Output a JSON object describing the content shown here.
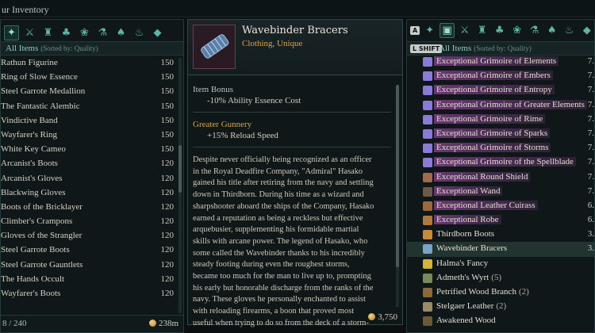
{
  "top": {
    "title": "ur Inventory"
  },
  "left": {
    "sort_label": "All Items",
    "sort_sub": "(Sorted by: Quality)",
    "partial_top": "...",
    "items": [
      {
        "name": "Rathun Figurine",
        "value": "150"
      },
      {
        "name": "Ring of Slow Essence",
        "value": "150"
      },
      {
        "name": "Steel Garrote Medallion",
        "value": "150"
      },
      {
        "name": "The Fantastic Alembic",
        "value": "150"
      },
      {
        "name": "Vindictive Band",
        "value": "150"
      },
      {
        "name": "Wayfarer's Ring",
        "value": "150"
      },
      {
        "name": "White Key Cameo",
        "value": "150"
      },
      {
        "name": "Arcanist's Boots",
        "value": "120"
      },
      {
        "name": "Arcanist's Gloves",
        "value": "120"
      },
      {
        "name": "Blackwing Gloves",
        "value": "120"
      },
      {
        "name": "Boots of the Bricklayer",
        "value": "120"
      },
      {
        "name": "Climber's Crampons",
        "value": "120"
      },
      {
        "name": "Gloves of the Strangler",
        "value": "120"
      },
      {
        "name": "Steel Garrote Boots",
        "value": "120"
      },
      {
        "name": "Steel Garrote Gauntlets",
        "value": "120"
      },
      {
        "name": "The Hands Occult",
        "value": "120"
      },
      {
        "name": "Wayfarer's Boots",
        "value": "120"
      }
    ],
    "footer_count": "8 / 240",
    "footer_gold": "238m"
  },
  "middle": {
    "item_name": "Wavebinder Bracers",
    "item_sub": "Clothing, Unique",
    "bonus_title": "Item Bonus",
    "bonus_line": "-10% Ability Essence Cost",
    "gunnery_title": "Greater Gunnery",
    "gunnery_line": "+15% Reload Speed",
    "description": "Despite never officially being recognized as an officer\nin the Royal Deadfire Company, \"Admiral\" Hasako\ngained his title after retiring from the navy and settling\ndown in Thirdborn. During his time as a wizard and\nsharpshooter aboard the ships of the Company, Hasako\nearned a reputation as being a reckless but effective\narquebusier, supplementing his formidable martial\nskills with arcane power. The legend of Hasako, who\nsome called the Wavebinder thanks to his incredibly\nsteady footing during even the roughest storms,\nbecame too much for the man to live up to, prompting\nhis early but honorable discharge from the ranks of the\nnavy. These gloves he personally enchanted to assist\nwith reloading firearms, a boon that proved most\nuseful when trying to do so from the deck of a storm-",
    "footer_gold": "3,750"
  },
  "right": {
    "key_a": "A",
    "key_shift": "L SHIFT",
    "sort_label": "All Items",
    "sort_sub": "(Sorted by: Quality)",
    "items": [
      {
        "name": "Exceptional Grimoire of Elements",
        "value": "7.",
        "exceptional": true,
        "icon": "book-icon",
        "color": "#8a7bd6"
      },
      {
        "name": "Exceptional Grimoire of Embers",
        "value": "7.",
        "exceptional": true,
        "icon": "book-icon",
        "color": "#8a7bd6"
      },
      {
        "name": "Exceptional Grimoire of Entropy",
        "value": "7.",
        "exceptional": true,
        "icon": "book-icon",
        "color": "#8a7bd6"
      },
      {
        "name": "Exceptional Grimoire of Greater Elements",
        "value": "7.",
        "exceptional": true,
        "icon": "book-icon",
        "color": "#8a7bd6"
      },
      {
        "name": "Exceptional Grimoire of Rime",
        "value": "7.",
        "exceptional": true,
        "icon": "book-icon",
        "color": "#8a7bd6"
      },
      {
        "name": "Exceptional Grimoire of Sparks",
        "value": "7.",
        "exceptional": true,
        "icon": "book-icon",
        "color": "#8a7bd6"
      },
      {
        "name": "Exceptional Grimoire of Storms",
        "value": "7.",
        "exceptional": true,
        "icon": "book-icon",
        "color": "#8a7bd6"
      },
      {
        "name": "Exceptional Grimoire of the Spellblade",
        "value": "7.",
        "exceptional": true,
        "icon": "book-icon",
        "color": "#8a7bd6"
      },
      {
        "name": "Exceptional Round Shield",
        "value": "7.",
        "exceptional": true,
        "icon": "shield-icon",
        "color": "#a26a4a"
      },
      {
        "name": "Exceptional Wand",
        "value": "7.",
        "exceptional": true,
        "icon": "wand-icon",
        "color": "#6b5a4a"
      },
      {
        "name": "Exceptional Leather Cuirass",
        "value": "6.",
        "exceptional": true,
        "icon": "armor-icon",
        "color": "#9a6a3e"
      },
      {
        "name": "Exceptional Robe",
        "value": "6.",
        "exceptional": true,
        "icon": "robe-icon",
        "color": "#b07a3e"
      },
      {
        "name": "Thirdborn Boots",
        "value": "3.",
        "exceptional": false,
        "icon": "boots-icon",
        "color": "#c78a3a"
      },
      {
        "name": "Wavebinder Bracers",
        "value": "3.",
        "exceptional": false,
        "icon": "bracers-icon",
        "color": "#7aa3c8",
        "selected": true
      },
      {
        "name": "Halma's Fancy",
        "value": "",
        "exceptional": false,
        "icon": "ring-icon",
        "color": "#d6b33a"
      },
      {
        "name": "Admeth's Wyrt",
        "qty": "(5)",
        "value": "",
        "exceptional": false,
        "icon": "herb-icon",
        "color": "#7a8a5a"
      },
      {
        "name": "Petrified Wood Branch",
        "qty": "(2)",
        "value": "",
        "exceptional": false,
        "icon": "branch-icon",
        "color": "#8a6a3a"
      },
      {
        "name": "Stelgaer Leather",
        "qty": "(2)",
        "value": "",
        "exceptional": false,
        "icon": "leather-icon",
        "color": "#9a8a6a"
      },
      {
        "name": "Awakened Wood",
        "value": "",
        "exceptional": false,
        "icon": "wood-icon",
        "color": "#6a5a3a"
      }
    ]
  },
  "colors": {
    "accent": "#5fb3a6",
    "exceptional": "#7b3e82",
    "unique": "#d6a645"
  }
}
